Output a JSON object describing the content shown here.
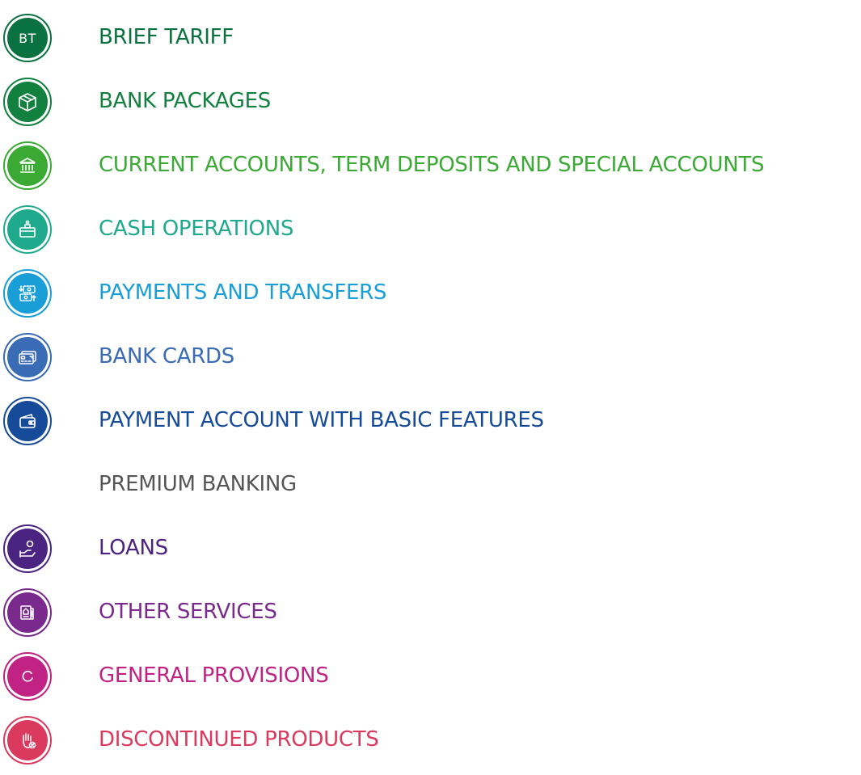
{
  "menu": {
    "items": [
      {
        "label": "BRIEF TARIFF",
        "icon": "bt-initials",
        "badge_text": "BT",
        "color": "#0a7240"
      },
      {
        "label": "BANK PACKAGES",
        "icon": "package-box-icon",
        "color": "#12803f"
      },
      {
        "label": "CURRENT ACCOUNTS, TERM DEPOSITS AND SPECIAL ACCOUNTS",
        "icon": "bank-building-icon",
        "color": "#3aaa35"
      },
      {
        "label": "CASH OPERATIONS",
        "icon": "cash-register-icon",
        "color": "#1faa8e"
      },
      {
        "label": "PAYMENTS AND TRANSFERS",
        "icon": "money-transfer-icon",
        "color": "#1a9ed8"
      },
      {
        "label": "BANK CARDS",
        "icon": "credit-card-icon",
        "color": "#3a6cb5"
      },
      {
        "label": "PAYMENT ACCOUNT WITH BASIC FEATURES",
        "icon": "wallet-icon",
        "color": "#164b9a"
      },
      {
        "label": "PREMIUM BANKING",
        "icon": "",
        "color": "#555555"
      },
      {
        "label": "LOANS",
        "icon": "hand-coin-icon",
        "color": "#4b2482"
      },
      {
        "label": "OTHER SERVICES",
        "icon": "documents-icon",
        "color": "#7a2a8c"
      },
      {
        "label": "GENERAL PROVISIONS",
        "icon": "refresh-icon",
        "color": "#c02384"
      },
      {
        "label": "DISCONTINUED PRODUCTS",
        "icon": "stop-hand-icon",
        "color": "#da3a5e"
      }
    ]
  }
}
